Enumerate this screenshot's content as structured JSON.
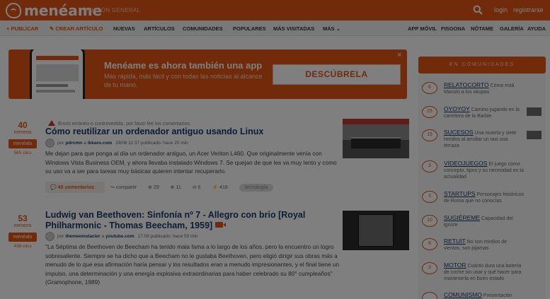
{
  "header": {
    "logo": "menéame",
    "edition": "EDICIÓN GENERAL",
    "login": "login",
    "register": "registrarse"
  },
  "subnav": {
    "publish": "+ PUBLICAR",
    "create_article": "✎ CREAR ARTÍCULO",
    "items": [
      "NUEVAS",
      "ARTÍCULOS",
      "COMUNIDADES",
      "POPULARES",
      "MÁS VISITADAS",
      "MÁS ⌄"
    ],
    "right_items": [
      "APP MÓVIL",
      "FISGONA",
      "NÓTAME",
      "GALERÍA",
      "AYUDA"
    ]
  },
  "banner": {
    "title": "Menéame es ahora también una app",
    "subtitle": "Más rápida, más fácil y con todas las noticias al alcance de tu mano.",
    "button": "DESCÚBRELA",
    "close": "×"
  },
  "stories": [
    {
      "votes": "40",
      "votes_unit": "meneos",
      "vote_button": "menéalo",
      "clicks": "565 clics",
      "warning": "Envío erróneo o controvertido, por favor lee los comentarios.",
      "title": "Cómo reutilizar un ordenador antiguo usando Linux",
      "author": "pdrcmn",
      "domain": "ikkaro.com",
      "published": "29/08 11:37 publicado: hace 20 min",
      "description": "Me dejan para que ponga al día un ordenador antiguo, un Acer Veriton L460. Que originalmente venía con Windows Vista Business OEM, y ahora llevaba instalado Windows 7. Se quejan de que les va muy lento y como su uso va a ser para tareas muy básicas quieren intentar recuperarlo.",
      "comments": "40 comentarios",
      "share": "compartir",
      "stats": [
        "29",
        "11",
        "6",
        "418"
      ],
      "tag": "tecnología"
    },
    {
      "votes": "53",
      "votes_unit": "meneos",
      "vote_button": "menéalo",
      "clicks": "438 clics",
      "title": "Ludwig van Beethoven: Sinfonía nº 7 - Allegro con brio [Royal Philharmonic - Thomas Beecham, 1959]",
      "author": "themeemxlacier",
      "domain": "youtube.com",
      "published": "17:09 publicado: hace 50 min",
      "description": "\"La Séptima de Beethoven de Beecham ha tenido mala fama a lo largo de los años, pero la encuentro un logro sobresaliente. Siempre se ha dicho que a Beecham no le gustaba Beethoven, pero eligió dirigir sus obras más a menudo de lo que esa afirmación haría pensar y los resultados eran a menudo impresionantes, y el final tiene un impulso, una determinación y una energía explosiva extraordinarias para haber celebrado su 80° cumpleaños\" (Gramophone, 1989)"
    }
  ],
  "sidebar": {
    "heading": "EN COMUNIDADES",
    "items": [
      {
        "count": "6",
        "name": "RELATOCORTO",
        "text": "Cómo está Manolo a los okupas"
      },
      {
        "count": "25",
        "name": "OYOYOY",
        "text": "Camino jugando en la carretera de la Barbie"
      },
      {
        "count": "15",
        "name": "SUCESOS",
        "text": "Una muerta y siete heridos al arrollar un taxi una terraza"
      },
      {
        "count": "3",
        "name": "VIDEOJUEGOS",
        "text": "El juego como concepto, tipos y su necesidad en la actualidad"
      },
      {
        "count": "3",
        "name": "STARTUPS",
        "text": "Personajes históricos de Roma que no conocías"
      },
      {
        "count": "10",
        "name": "SUGIÉREME",
        "text": "Capacidad del ignore"
      },
      {
        "count": "8",
        "name": "RETUIT",
        "text": "No son medios de vientos, son pijamas"
      },
      {
        "count": "3",
        "name": "MOTOR",
        "text": "Cuánto dura una batería de coche sin usar y qué hacer para mantenerla en buen estado"
      },
      {
        "count": "",
        "name": "COMUNISMO",
        "text": "Presentación"
      }
    ]
  }
}
